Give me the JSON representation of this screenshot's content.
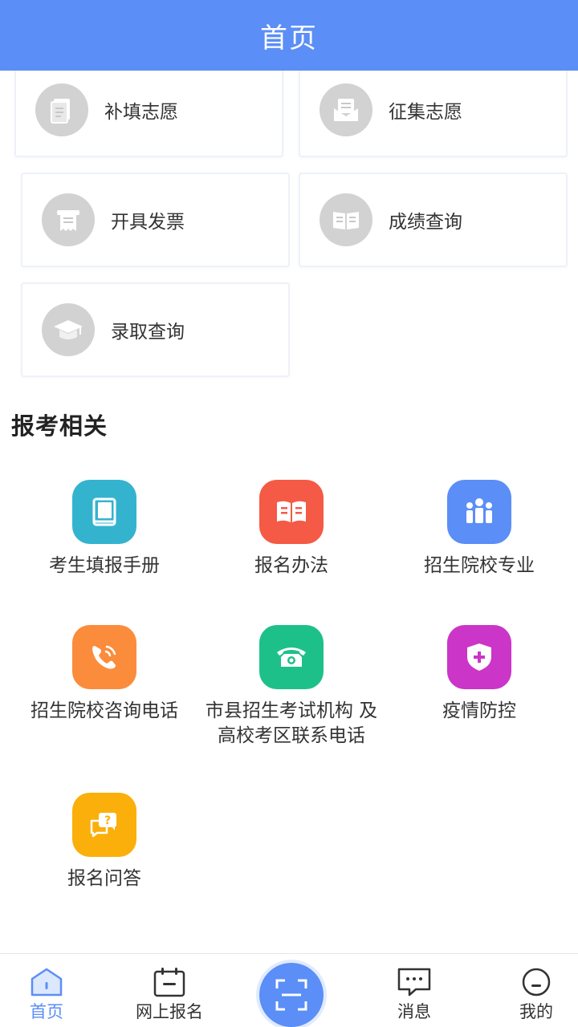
{
  "header": {
    "title": "首页"
  },
  "cards": [
    {
      "label": "补填志愿",
      "icon": "document-icon"
    },
    {
      "label": "征集志愿",
      "icon": "envelope-icon"
    },
    {
      "label": "开具发票",
      "icon": "receipt-icon"
    },
    {
      "label": "成绩查询",
      "icon": "open-book-icon"
    },
    {
      "label": "录取查询",
      "icon": "graduation-cap-icon"
    }
  ],
  "section": {
    "title": "报考相关"
  },
  "grid": [
    {
      "label": "考生填报手册",
      "icon": "handbook-icon",
      "color": "#34b3cf"
    },
    {
      "label": "报名办法",
      "icon": "book-icon",
      "color": "#f45a45"
    },
    {
      "label": "招生院校专业",
      "icon": "people-icon",
      "color": "#5b8ef6"
    },
    {
      "label": "招生院校咨询电话",
      "icon": "phone-call-icon",
      "color": "#fb8c3c"
    },
    {
      "label": "市县招生考试机构 及\n高校考区联系电话",
      "icon": "telephone-icon",
      "color": "#1ec08a"
    },
    {
      "label": "疫情防控",
      "icon": "shield-plus-icon",
      "color": "#cb35c8"
    },
    {
      "label": "报名问答",
      "icon": "question-chat-icon",
      "color": "#fbaf0b"
    }
  ],
  "tabbar": {
    "items": [
      {
        "label": "首页",
        "icon": "home-icon",
        "active": true
      },
      {
        "label": "网上报名",
        "icon": "calendar-icon",
        "active": false
      },
      {
        "label": "消息",
        "icon": "message-icon",
        "active": false
      },
      {
        "label": "我的",
        "icon": "user-icon",
        "active": false
      }
    ],
    "center_icon": "scan-icon",
    "accent": "#5b8ef6"
  }
}
